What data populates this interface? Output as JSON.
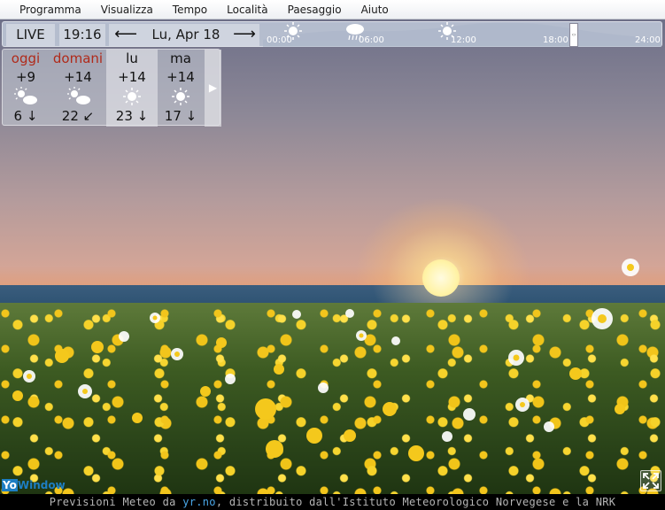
{
  "menu": [
    "Programma",
    "Visualizza",
    "Tempo",
    "Località",
    "Paesaggio",
    "Aiuto"
  ],
  "topbar": {
    "live_label": "LIVE",
    "time": "19:16",
    "date": "Lu, Apr 18",
    "timeline_labels": [
      "00:00",
      "06:00",
      "12:00",
      "18:00",
      "24:00"
    ],
    "timeline_icons": [
      "sun-icon",
      "rain-cloud-icon",
      "sun-icon"
    ]
  },
  "forecast": [
    {
      "name": "oggi",
      "temp": "+9",
      "icon": "sun-cloud-icon",
      "wind": "6 ↓",
      "highlight": true
    },
    {
      "name": "domani",
      "temp": "+14",
      "icon": "sun-cloud-icon",
      "wind": "22 ↙",
      "highlight": true
    },
    {
      "name": "lu",
      "temp": "+14",
      "icon": "sun-icon",
      "wind": "23 ↓",
      "highlight": false
    },
    {
      "name": "ma",
      "temp": "+14",
      "icon": "sun-icon",
      "wind": "17 ↓",
      "highlight": false
    }
  ],
  "more_arrow": "▶",
  "logo": {
    "part1": "Yo",
    "part2": "Window"
  },
  "footer": {
    "prefix": "Previsioni Meteo da ",
    "link": "yr.no",
    "suffix": ", distribuito dall'Istituto Meteorologico Norvegese e la NRK"
  },
  "colors": {
    "accent": "#1d7ec3",
    "day_red": "#b02a1a"
  }
}
